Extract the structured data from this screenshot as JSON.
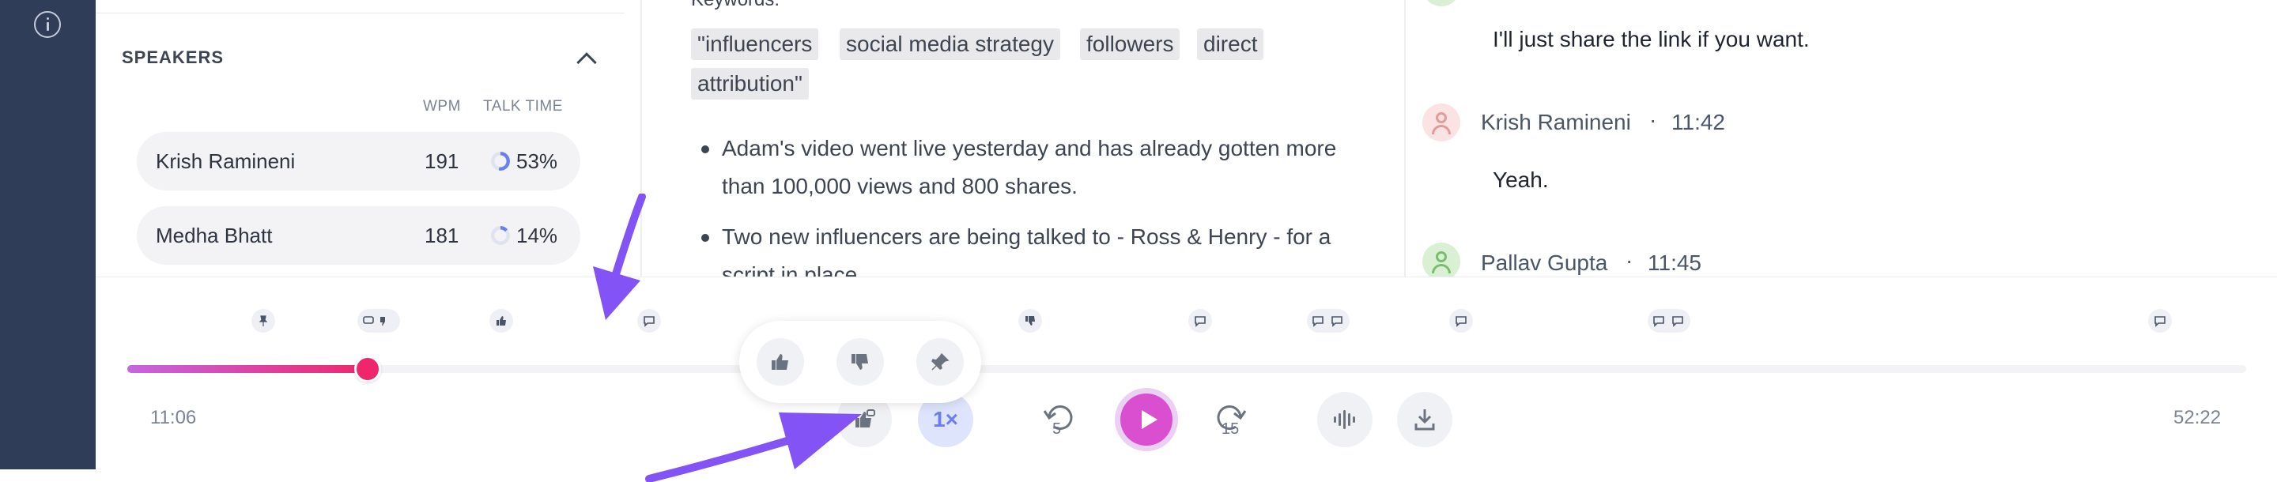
{
  "rail": {
    "info_icon": "info-icon"
  },
  "speakers": {
    "title": "SPEAKERS",
    "columns": {
      "wpm": "WPM",
      "talk_time": "TALK TIME"
    },
    "rows": [
      {
        "name": "Krish Ramineni",
        "wpm": "191",
        "talk_time": "53%",
        "talk_fraction": 0.53
      },
      {
        "name": "Medha Bhatt",
        "wpm": "181",
        "talk_time": "14%",
        "talk_fraction": 0.14
      }
    ]
  },
  "notes": {
    "keywords_heading": "Keywords:",
    "keywords": [
      "\"influencers",
      "social media strategy",
      "followers",
      "direct",
      "attribution\""
    ],
    "bullets": [
      "Adam's video went live yesterday and has already gotten more than 100,000 views and 800 shares.",
      "Two new influencers are being talked to - Ross & Henry - for a script in place."
    ]
  },
  "transcript": {
    "entries": [
      {
        "message": "I'll just share the link if you want."
      },
      {
        "speaker": "Krish Ramineni",
        "separator": "·",
        "time": "11:42",
        "message": "Yeah."
      },
      {
        "speaker": "Pallav Gupta",
        "separator": "·",
        "time": "11:45"
      }
    ]
  },
  "player": {
    "current_time": "11:06",
    "duration": "52:22",
    "progress_fraction": 0.1133,
    "speed_label": "1×",
    "rewind_label": "5",
    "forward_label": "15",
    "accent_colors": {
      "progress_start": "#c466e0",
      "progress_end": "#f0266d",
      "play": "#d94fd0",
      "arrow": "#8353f5"
    },
    "markers": [
      {
        "icon": "pin-icon"
      },
      {
        "icon": "comment-dislike-icon"
      },
      {
        "icon": "thumbs-up-icon"
      },
      {
        "icon": "comment-icon"
      },
      {
        "icon": "thumbs-down-icon"
      },
      {
        "icon": "comment-icon"
      },
      {
        "icon": "comment-comment-icon"
      },
      {
        "icon": "comment-icon"
      },
      {
        "icon": "comment-comment-icon"
      },
      {
        "icon": "comment-icon"
      }
    ],
    "reaction_popover": [
      "thumbs-up-icon",
      "thumbs-down-icon",
      "pin-icon"
    ]
  }
}
